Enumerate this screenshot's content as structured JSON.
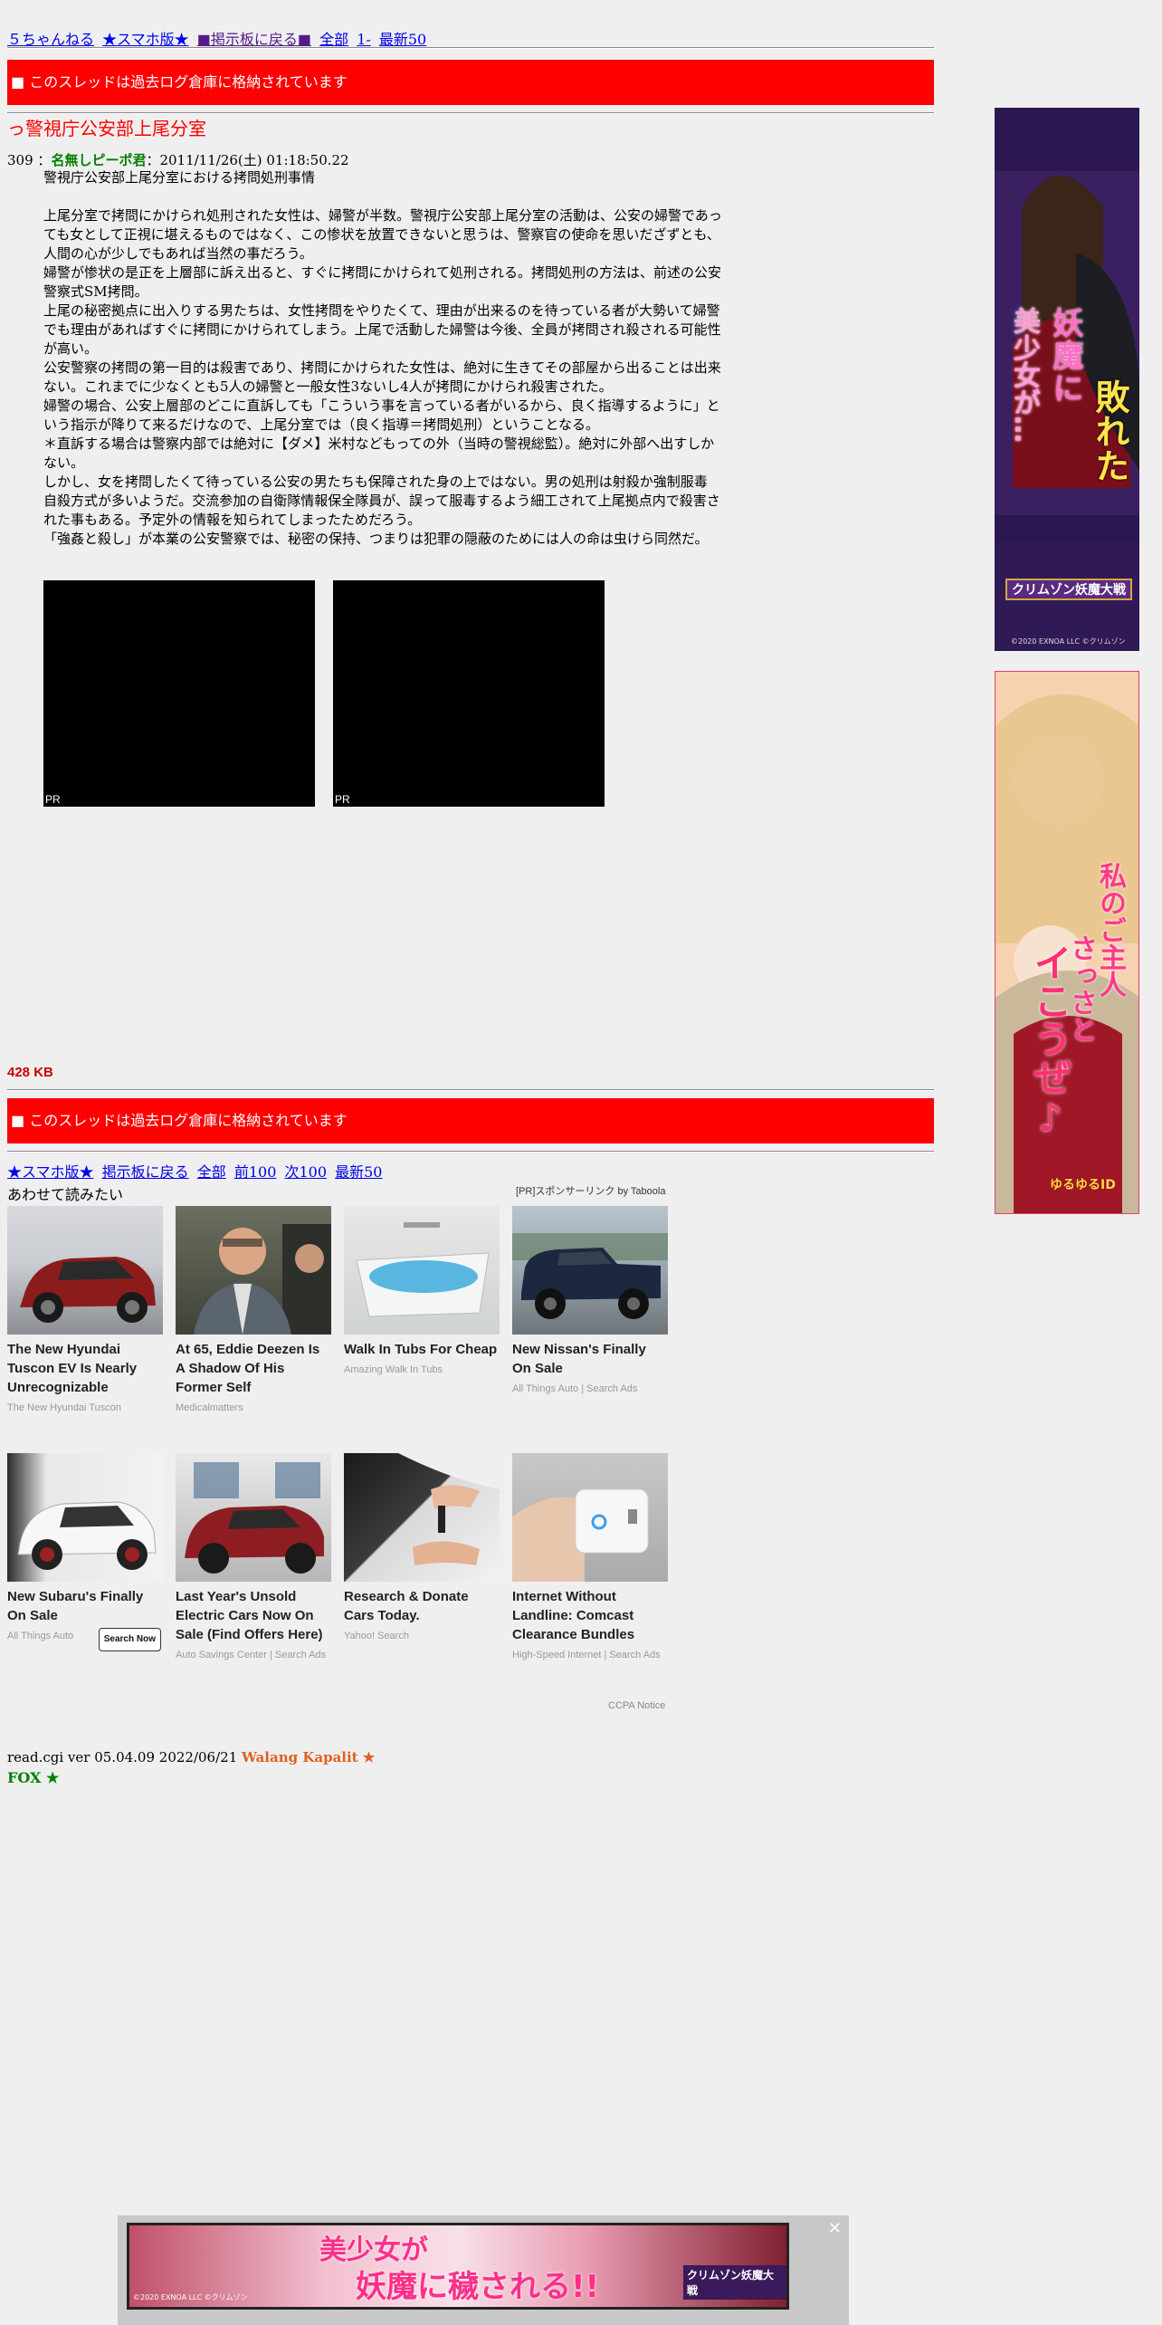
{
  "top_nav": {
    "board": "５ちゃんねる",
    "smartphone": "★スマホ版★",
    "back": "■掲示板に戻る■",
    "all": "全部",
    "range": "1-",
    "latest": "最新50"
  },
  "archived_notice": "■ このスレッドは過去ログ倉庫に格納されています",
  "thread_title": "っ警視庁公安部上尾分室",
  "post": {
    "number": "309",
    "separator": "：",
    "name": "名無しピーポ君",
    "date": "：2011/11/26(土) 01:18:50.22",
    "lines": [
      "警視庁公安部上尾分室における拷問処刑事情",
      "",
      "上尾分室で拷問にかけられ処刑された女性は、婦警が半数。警視庁公安部上尾分室の活動は、公安の婦警であっ",
      "ても女として正視に堪えるものではなく、この惨状を放置できないと思うは、警察官の使命を思いだざずとも、",
      "人間の心が少しでもあれば当然の事だろう。",
      "婦警が惨状の是正を上層部に訴え出ると、すぐに拷問にかけられて処刑される。拷問処刑の方法は、前述の公安",
      "警察式SM拷問。",
      "上尾の秘密拠点に出入りする男たちは、女性拷問をやりたくて、理由が出来るのを待っている者が大勢いて婦警",
      "でも理由があればすぐに拷問にかけられてしまう。上尾で活動した婦警は今後、全員が拷問され殺される可能性",
      "が高い。",
      "公安警察の拷問の第一目的は殺害であり、拷問にかけられた女性は、絶対に生きてその部屋から出ることは出来",
      "ない。これまでに少なくとも5人の婦警と一般女性3ないし4人が拷問にかけられ殺害された。",
      "婦警の場合、公安上層部のどこに直訴しても「こういう事を言っている者がいるから、良く指導するように」と",
      "いう指示が降りて来るだけなので、上尾分室では（良く指導＝拷問処刑）ということなる。",
      "＊直訴する場合は警察内部では絶対に【ダメ】米村などもっての外（当時の警視総監）。絶対に外部へ出すしか",
      "ない。",
      "しかし、女を拷問したくて待っている公安の男たちも保障された身の上ではない。男の処刑は射殺か強制服毒",
      "自殺方式が多いようだ。交流参加の自衛隊情報保全隊員が、誤って服毒するよう細工されて上尾拠点内で殺害さ",
      "れた事もある。予定外の情報を知られてしまったためだろう。",
      "「強姦と殺し」が本業の公安警察では、秘密の保持、つまりは犯罪の隠蔽のためには人の命は虫けら同然だ。"
    ]
  },
  "ads": {
    "pr_label": "PR",
    "side1_title_a": "妖魔に",
    "side1_title_b": "敗れた",
    "side1_title_c": "美少女が…",
    "side1_brand": "クリムゾン妖魔大戦",
    "side1_copy": "©2020 EXNOA LLC ©クリムゾン",
    "side2_title_a": "私のご主人",
    "side2_title_b": "さっさと",
    "side2_title_c": "イこうぜ♪",
    "side2_brand": "ゆるゆるID",
    "bottom_title_a": "美少女が",
    "bottom_title_b": "妖魔に穢される!!",
    "bottom_brand": "クリムゾン妖魔大戦",
    "bottom_copy": "©2020 EXNOA LLC ©クリムゾン",
    "close": "✕"
  },
  "size": "428 KB",
  "bottom_nav": {
    "smartphone": "★スマホ版★",
    "back": "掲示板に戻る",
    "all": "全部",
    "prev": "前100",
    "next": "次100",
    "latest": "最新50"
  },
  "related": {
    "heading": "あわせて読みたい",
    "sponsor": "[PR]スポンサーリンク by Taboola",
    "cards": [
      {
        "title": "The New Hyundai Tuscon EV Is Nearly Unrecognizable",
        "source": "The New Hyundai Tuscon"
      },
      {
        "title": "At 65, Eddie Deezen Is A Shadow Of His Former Self",
        "source": "Medicalmatters"
      },
      {
        "title": "Walk In Tubs For Cheap",
        "source": "Amazing Walk In Tubs"
      },
      {
        "title": "New Nissan's Finally On Sale",
        "source": "All Things Auto | Search Ads"
      },
      {
        "title": "New Subaru's Finally On Sale",
        "source": "All Things Auto",
        "button": "Search Now"
      },
      {
        "title": "Last Year's Unsold Electric Cars Now On Sale (Find Offers Here)",
        "source": "Auto Savings Center | Search Ads"
      },
      {
        "title": "Research & Donate Cars Today.",
        "source": "Yahoo! Search"
      },
      {
        "title": "Internet Without Landline: Comcast Clearance Bundles",
        "source": "High-Speed Internet | Search Ads"
      }
    ],
    "ccpa": "CCPA Notice"
  },
  "footer": {
    "version": "read.cgi ver 05.04.09 2022/06/21",
    "walang": "Walang Kapalit ★",
    "fox": "FOX ★"
  }
}
